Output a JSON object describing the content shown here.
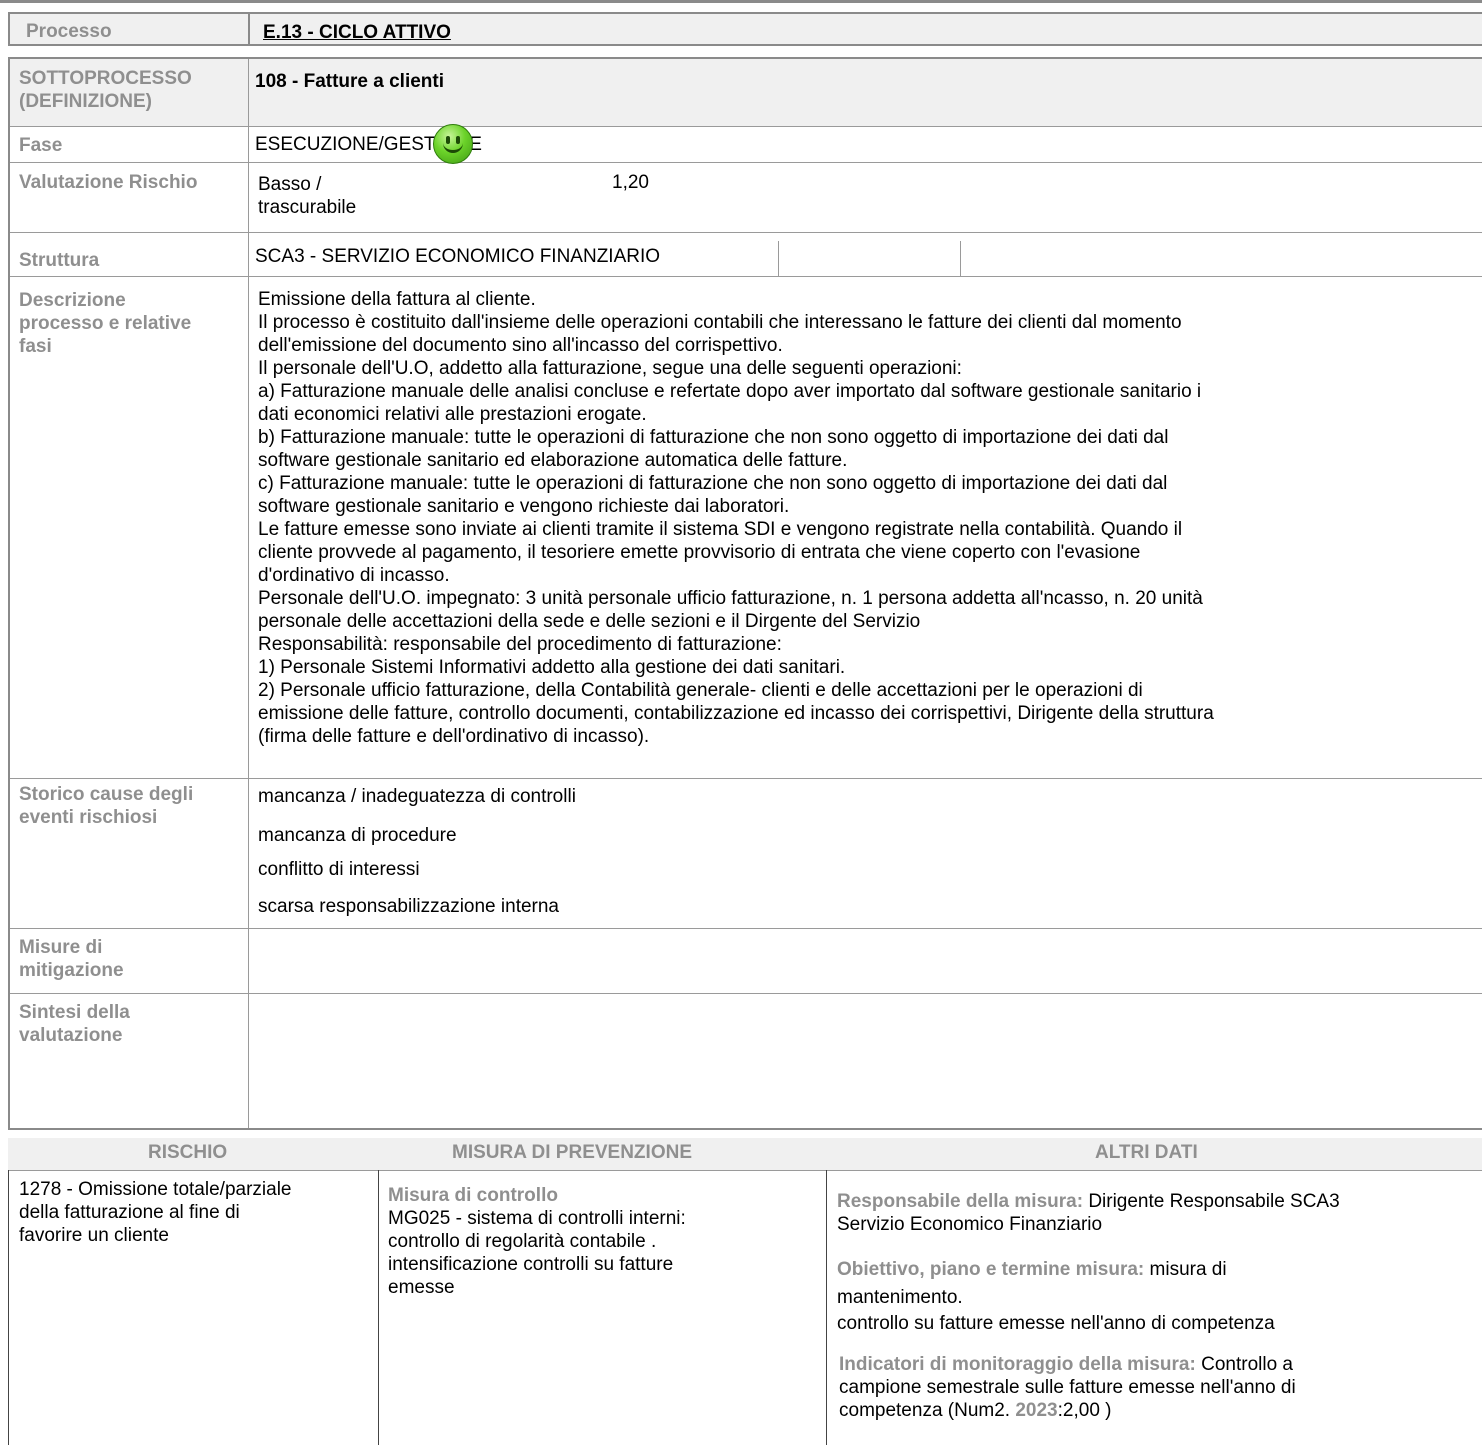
{
  "processo": {
    "label": "Processo",
    "value": "E.13 - CICLO ATTIVO"
  },
  "rows": {
    "sottoprocesso": {
      "label_line1": "SOTTOPROCESSO",
      "label_line2": "(DEFINIZIONE)",
      "value": "108 - Fatture a clienti"
    },
    "fase": {
      "label": "Fase",
      "value": "ESECUZIONE/GESTIONE"
    },
    "valutazione": {
      "label": "Valutazione Rischio",
      "level_line1": "Basso /",
      "level_line2": "trascurabile",
      "icon": "smiley-green-icon",
      "score": "1,20"
    },
    "struttura": {
      "label": "Struttura",
      "value": "SCA3 - SERVIZIO ECONOMICO FINANZIARIO"
    },
    "descrizione": {
      "label_line1": "Descrizione",
      "label_line2": "processo e relative",
      "label_line3": "fasi",
      "text": "Emissione della fattura al cliente.\n Il processo è costituito dall'insieme delle operazioni contabili che interessano le fatture dei clienti dal momento\ndell'emissione del documento sino all'incasso del corrispettivo.\nIl personale dell'U.O, addetto alla fatturazione, segue una delle seguenti operazioni:\na) Fatturazione  manuale delle analisi concluse e refertate dopo aver importato dal software gestionale sanitario i\ndati economici relativi alle prestazioni erogate.\nb) Fatturazione manuale: tutte le operazioni di fatturazione che non sono oggetto di importazione dei dati dal\nsoftware gestionale sanitario ed elaborazione automatica delle fatture.\nc) Fatturazione manuale: tutte le operazioni di fatturazione che non sono oggetto di importazione dei dati dal\nsoftware gestionale sanitario e vengono richieste dai laboratori.\nLe fatture emesse sono inviate ai clienti tramite il sistema SDI e vengono registrate nella contabilità. Quando il\ncliente provvede al pagamento, il tesoriere emette provvisorio di entrata che viene coperto con l'evasione\nd'ordinativo di incasso.\nPersonale dell'U.O. impegnato: 3 unità personale ufficio fatturazione, n. 1 persona addetta all'ncasso, n. 20 unità\npersonale delle accettazioni della sede e delle sezioni e il Dirgente del Servizio\nResponsabilità: responsabile del procedimento di fatturazione:\n1) Personale Sistemi Informativi addetto alla gestione dei dati sanitari.\n2) Personale ufficio fatturazione, della Contabilità generale- clienti e delle accettazioni per le operazioni di\nemissione delle fatture, controllo documenti, contabilizzazione ed incasso dei corrispettivi, Dirigente della struttura\n(firma delle fatture e  dell'ordinativo di incasso)."
    },
    "storico": {
      "label_line1": "Storico cause degli",
      "label_line2": "eventi rischiosi",
      "causes": [
        "mancanza / inadeguatezza di controlli",
        "mancanza di procedure",
        "conflitto di interessi",
        "scarsa responsabilizzazione interna"
      ]
    },
    "misure": {
      "label_line1": "Misure di",
      "label_line2": "mitigazione"
    },
    "sintesi": {
      "label_line1": "Sintesi della",
      "label_line2": "valutazione"
    }
  },
  "risk_table": {
    "headers": [
      "RISCHIO",
      "MISURA DI PREVENZIONE",
      "ALTRI DATI"
    ],
    "rischio": {
      "line1": "1278 - Omissione totale/parziale",
      "line2": "della fatturazione al fine di",
      "line3": "favorire un cliente"
    },
    "misura": {
      "title": "Misura di controllo",
      "line1": "MG025 - sistema di controlli interni:",
      "line2": "controllo di regolarità contabile .",
      "line3": "intensificazione controlli su fatture",
      "line4": "emesse"
    },
    "altri": {
      "resp_label": "Responsabile della misura:",
      "resp_value1": "Dirigente Responsabile SCA3",
      "resp_value2": "Servizio Economico Finanziario",
      "obj_label": "Obiettivo, piano e termine misura:",
      "obj_value1": "misura di",
      "obj_value2": "mantenimento.",
      "obj_value3": "controllo su fatture emesse nell'anno di competenza",
      "ind_label": "Indicatori di monitoraggio della misura:",
      "ind_value1": "Controllo a",
      "ind_value2": "campione semestrale sulle fatture emesse nell'anno di",
      "ind_value3_pre": "competenza (Num2. ",
      "ind_year": "2023",
      "ind_value3_post": ":2,00  )"
    }
  }
}
